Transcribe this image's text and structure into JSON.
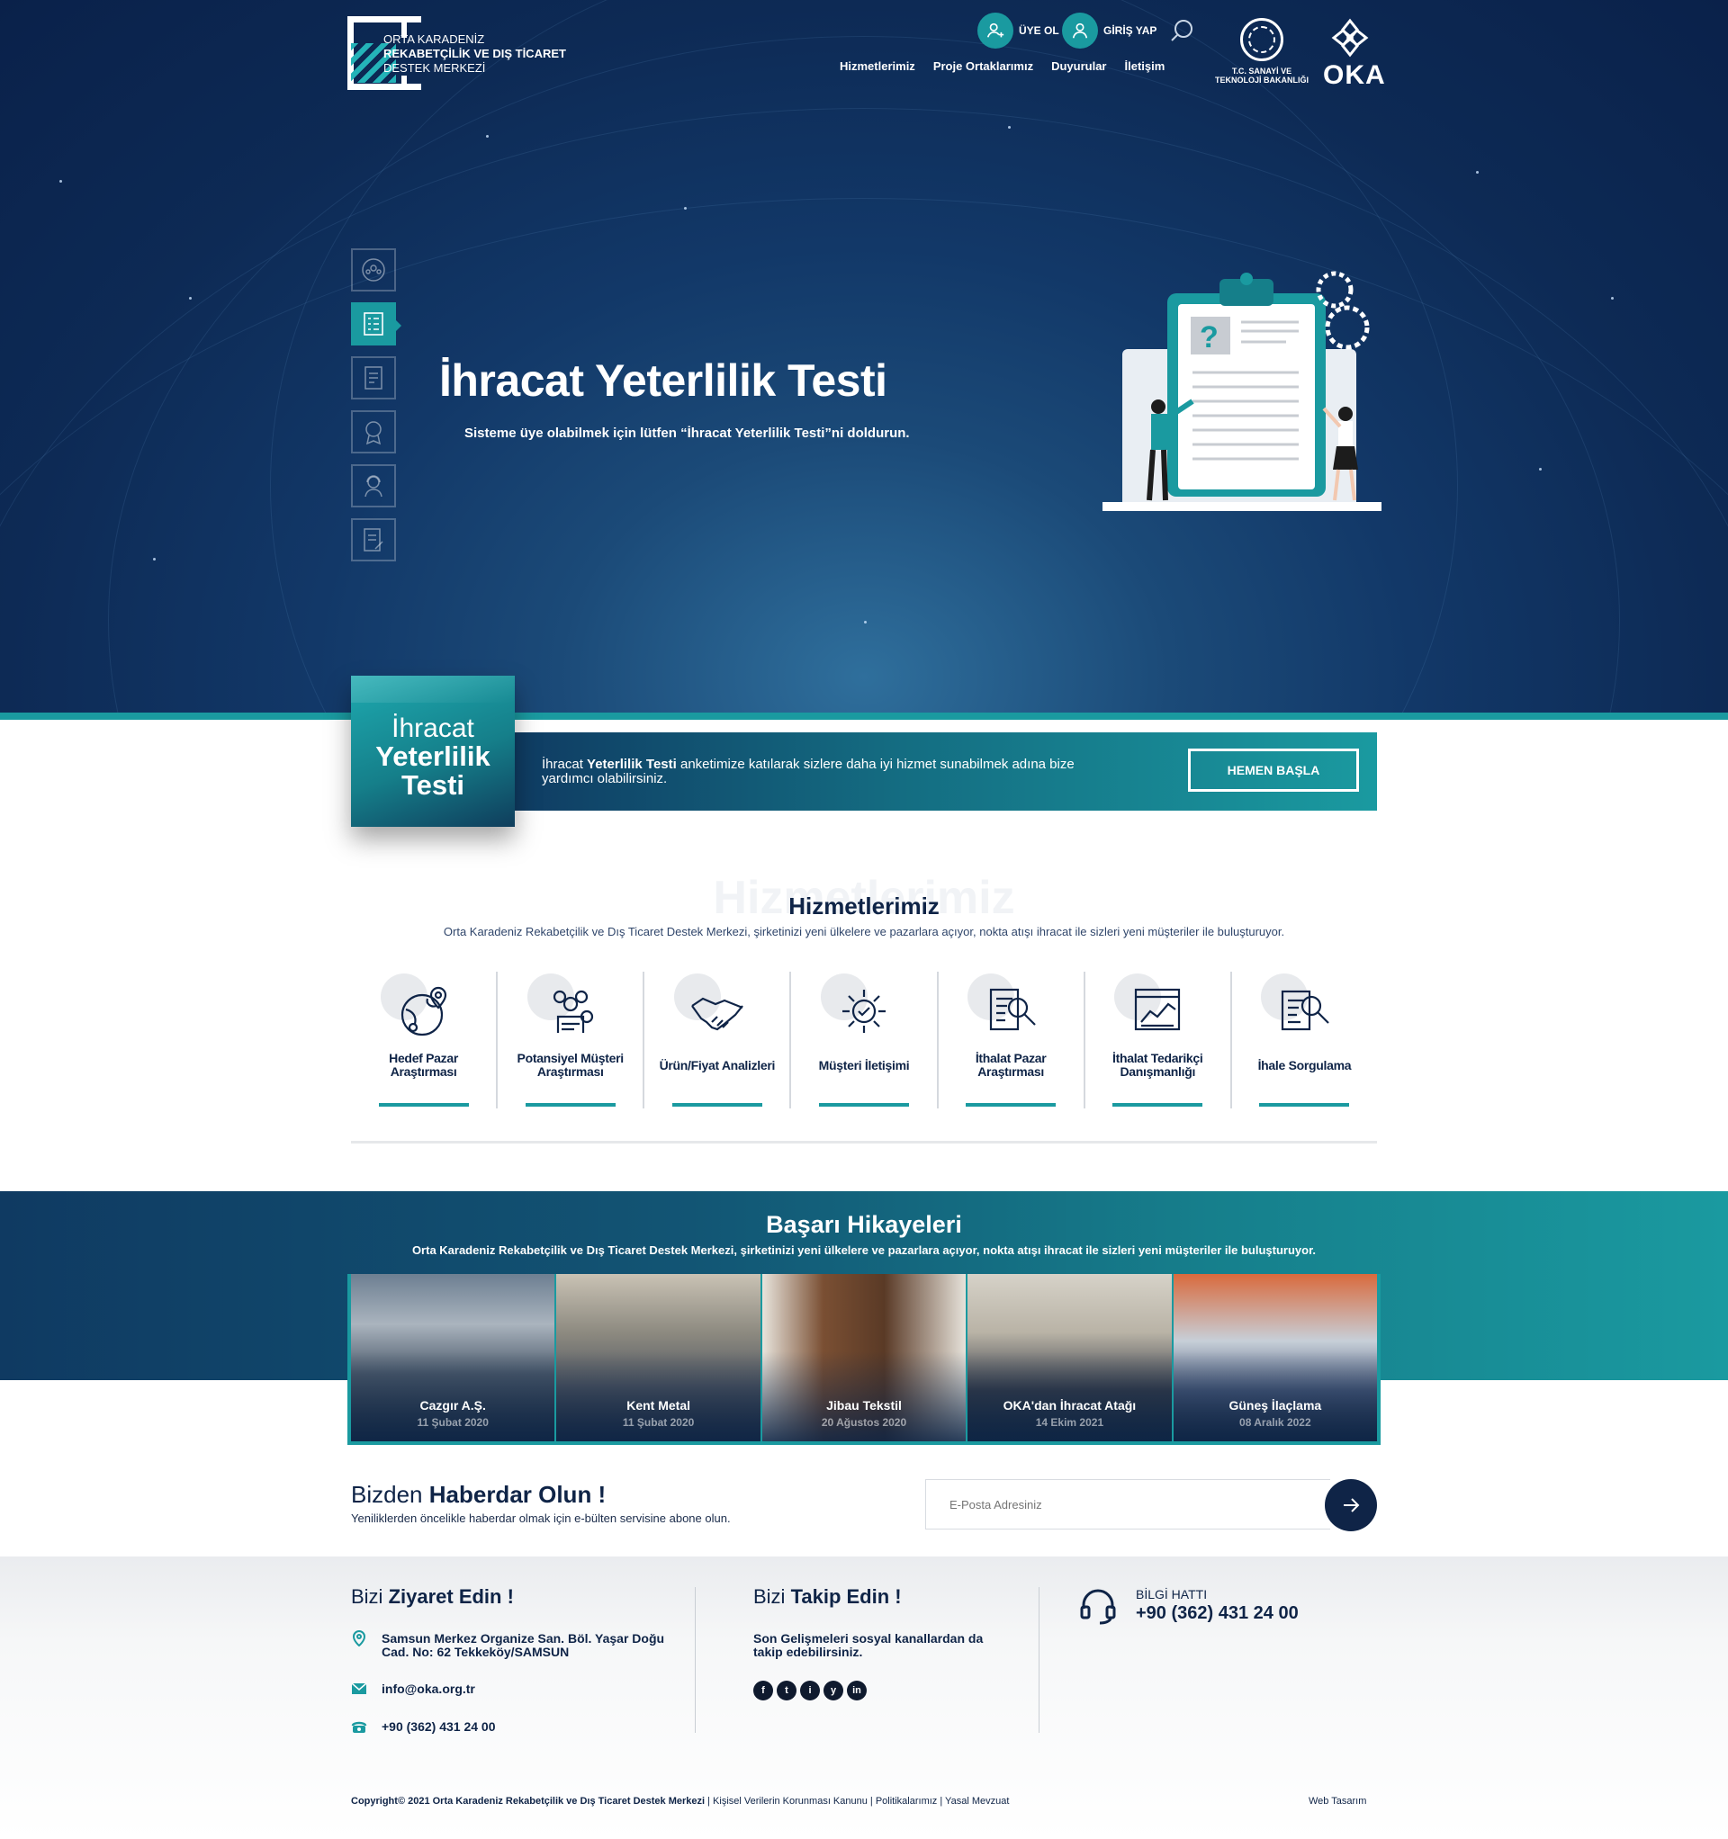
{
  "header": {
    "logo": {
      "line1": "ORTA KARADENİZ",
      "line2": "REKABETÇİLİK VE DIŞ TİCARET",
      "line3": "DESTEK MERKEZİ"
    },
    "register_label": "ÜYE OL",
    "login_label": "GİRİŞ YAP",
    "nav": [
      "Hizmetlerimiz",
      "Proje Ortaklarımız",
      "Duyurular",
      "İletişim"
    ],
    "ministry_line1": "T.C. SANAYİ VE",
    "ministry_line2": "TEKNOLOJİ BAKANLIĞI",
    "oka_label": "OKA"
  },
  "hero": {
    "title": "İhracat Yeterlilik Testi",
    "subtitle": "Sisteme üye olabilmek için lütfen “İhracat Yeterlilik Testi”ni doldurun.",
    "side_icons": [
      "globe-people-icon",
      "checklist-icon",
      "report-icon",
      "award-icon",
      "support-agent-icon",
      "document-sign-icon"
    ],
    "active_side_icon": 1
  },
  "cta": {
    "box_line1": "İhracat",
    "box_line2": "Yeterlilik",
    "box_line3": "Testi",
    "text_pre": "İhracat ",
    "text_bold": "Yeterlilik Testi",
    "text_post": " anketimize katılarak sizlere daha iyi hizmet sunabilmek adına bize yardımcı olabilirsiniz.",
    "button": "HEMEN BAŞLA"
  },
  "services": {
    "ghost": "Hizmetlerimiz",
    "title": "Hizmetlerimiz",
    "subtitle": "Orta Karadeniz Rekabetçilik ve Dış Ticaret Destek Merkezi, şirketinizi yeni ülkelere ve pazarlara açıyor, nokta atışı ihracat ile sizleri yeni müşteriler ile buluşturuyor.",
    "items": [
      {
        "label": "Hedef Pazar Araştırması",
        "icon": "target-market-icon"
      },
      {
        "label": "Potansiyel Müşteri Araştırması",
        "icon": "potential-customer-icon"
      },
      {
        "label": "Ürün/Fiyat Analizleri",
        "icon": "handshake-icon"
      },
      {
        "label": "Müşteri İletişimi",
        "icon": "gear-communication-icon"
      },
      {
        "label": "İthalat Pazar Araştırması",
        "icon": "document-search-icon"
      },
      {
        "label": "İthalat Tedarikçi Danışmanlığı",
        "icon": "chart-board-icon"
      },
      {
        "label": "İhale Sorgulama",
        "icon": "tender-search-icon"
      }
    ]
  },
  "stories": {
    "title": "Başarı Hikayeleri",
    "subtitle": "Orta Karadeniz Rekabetçilik ve Dış Ticaret Destek Merkezi, şirketinizi yeni ülkelere ve pazarlara açıyor, nokta atışı ihracat ile sizleri yeni müşteriler ile buluşturuyor.",
    "items": [
      {
        "name": "Cazgır A.Ş.",
        "date": "11 Şubat 2020"
      },
      {
        "name": "Kent Metal",
        "date": "11 Şubat 2020"
      },
      {
        "name": "Jibau Tekstil",
        "date": "20 Ağustos 2020"
      },
      {
        "name": "OKA'dan İhracat Atağı",
        "date": "14 Ekim 2021"
      },
      {
        "name": "Güneş İlaçlama",
        "date": "08 Aralık 2022"
      }
    ]
  },
  "newsletter": {
    "title_light": "Bizden ",
    "title_bold": "Haberdar Olun !",
    "subtitle": "Yeniliklerden öncelikle haberdar olmak için e-bülten servisine abone olun.",
    "placeholder": "E-Posta Adresiniz"
  },
  "footer": {
    "visit_light": "Bizi ",
    "visit_bold": "Ziyaret Edin !",
    "address": "Samsun Merkez Organize San. Böl. Yaşar Doğu Cad. No: 62 Tekkeköy/SAMSUN",
    "email": "info@oka.org.tr",
    "phone": "+90 (362) 431 24 00",
    "follow_light": "Bizi ",
    "follow_bold": "Takip Edin !",
    "follow_text": "Son Gelişmeleri sosyal kanallardan da takip edebilirsiniz.",
    "social": [
      "f",
      "t",
      "i",
      "y",
      "in"
    ],
    "hotline_label": "BİLGİ HATTI",
    "hotline_number": "+90 (362) 431 24 00",
    "copyright_bold": "Copyright© 2021 Orta Karadeniz Rekabetçilik ve Dış Ticaret Destek Merkezi",
    "links": " | Kişisel Verilerin Korunması Kanunu  | Politikalarımız  | Yasal Mevzuat",
    "web_design": "Web Tasarım"
  },
  "colors": {
    "navy": "#0f2447",
    "teal": "#1a9aa0",
    "hero_dark": "#0a214a"
  }
}
